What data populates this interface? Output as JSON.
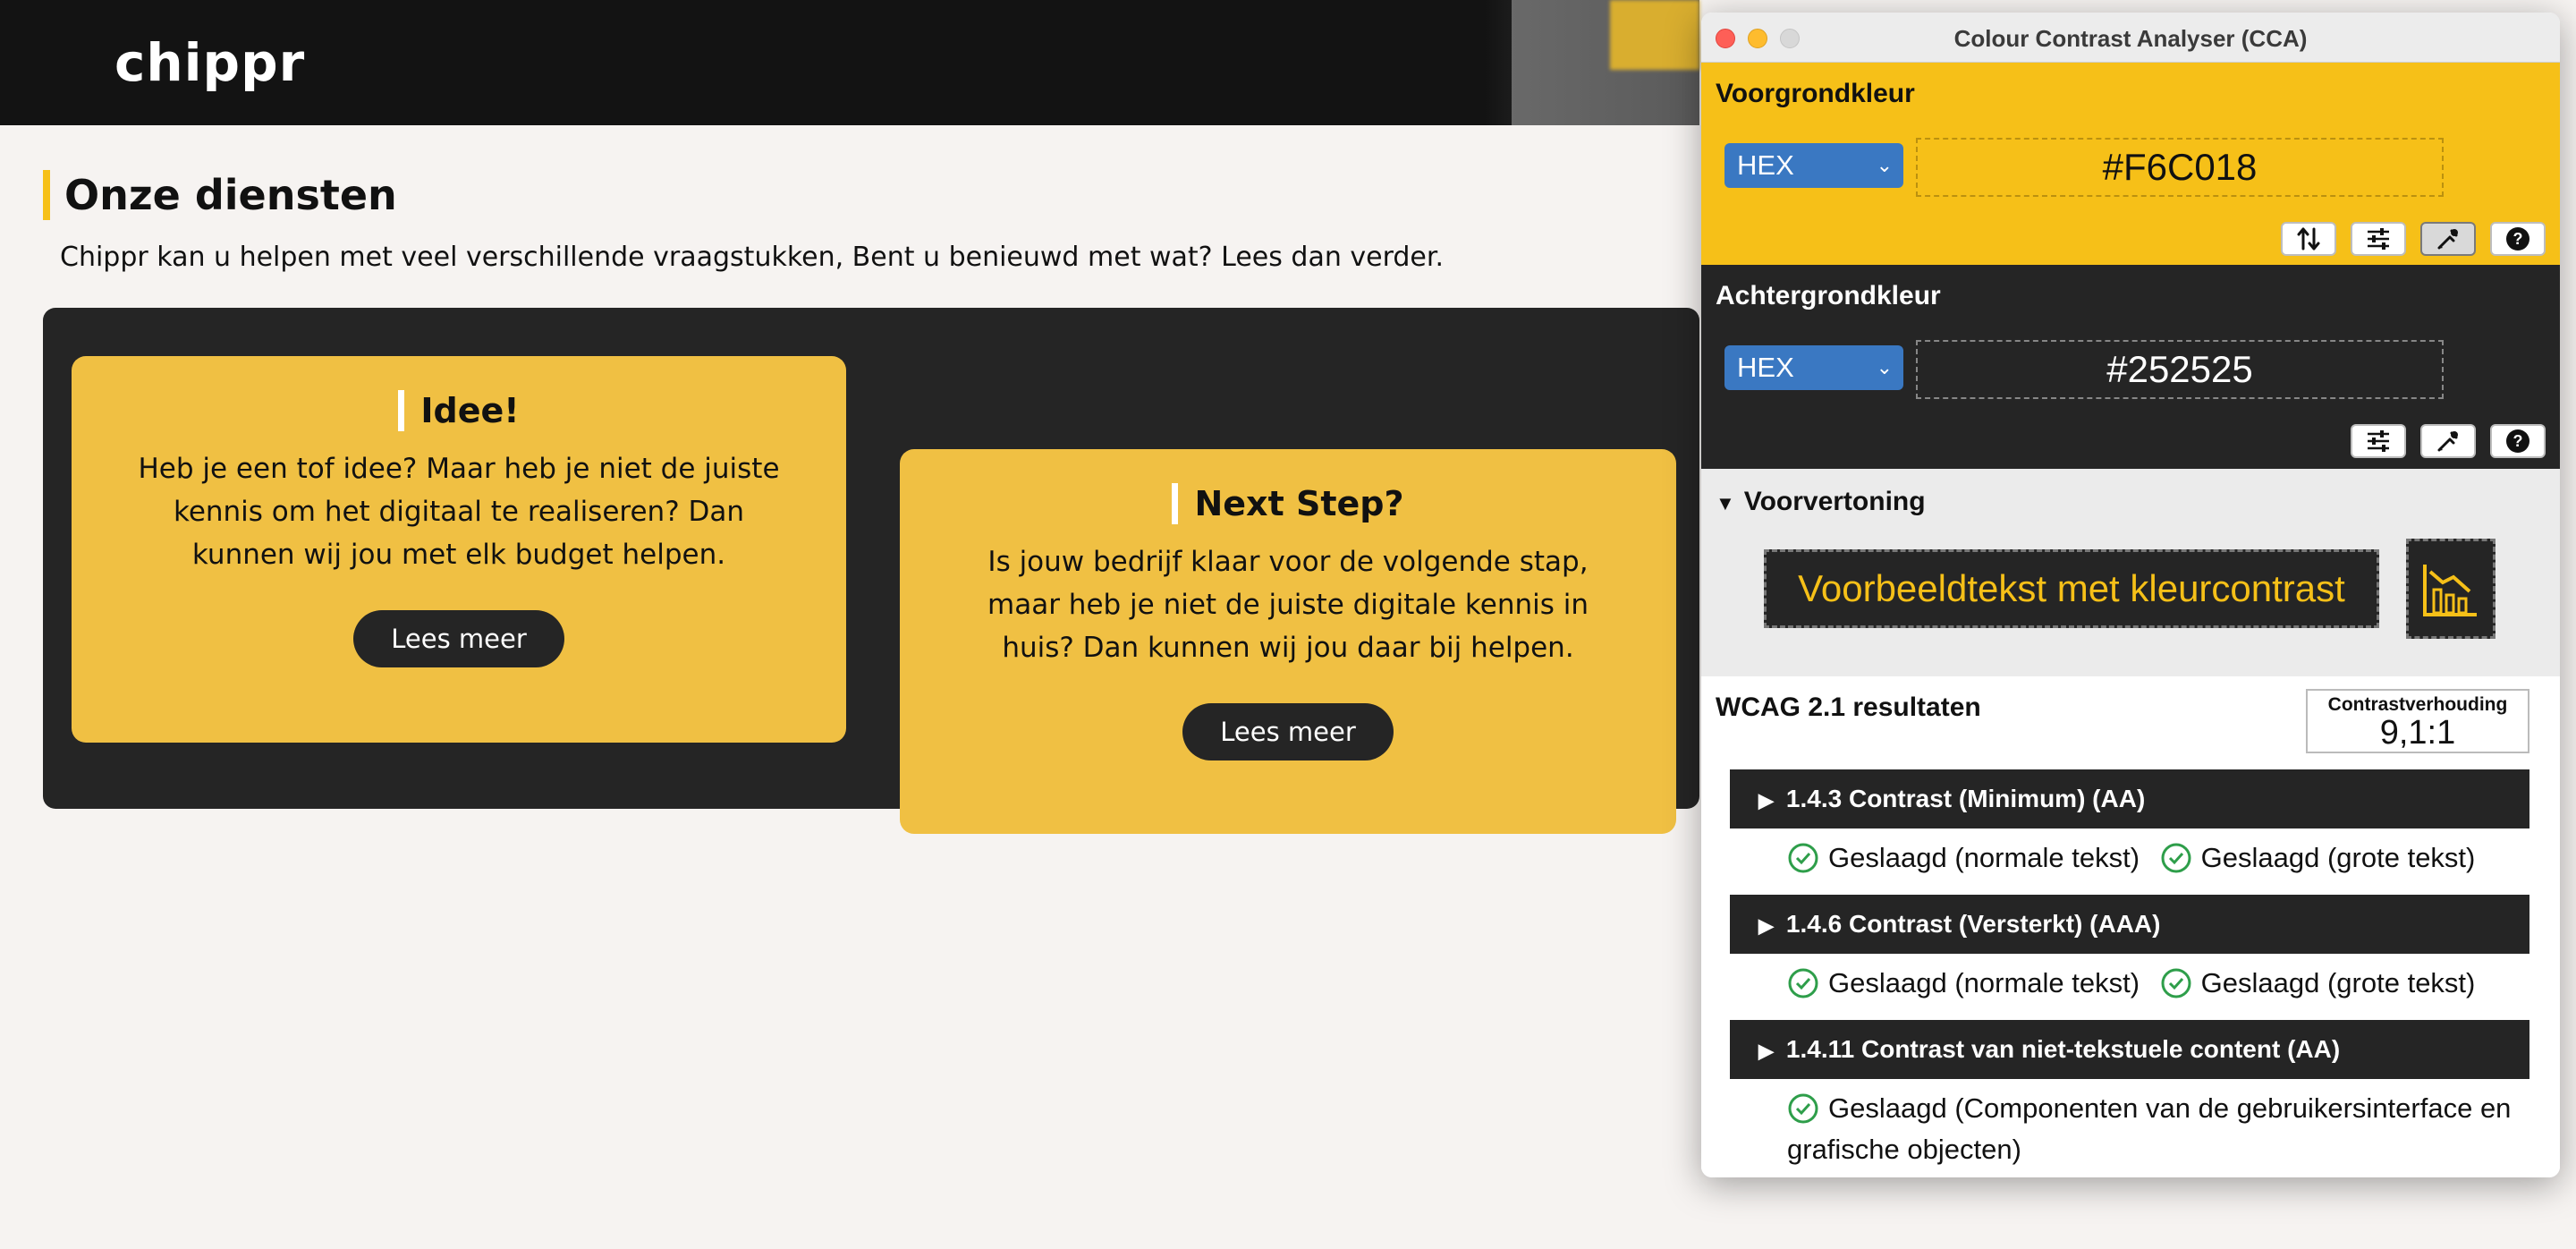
{
  "site": {
    "logo": "chippr",
    "section_title": "Onze diensten",
    "section_subtitle": "Chippr kan u helpen met veel verschillende vraagstukken, Bent u benieuwd met wat? Lees dan verder.",
    "cards": [
      {
        "title": "Idee!",
        "text": "Heb je een tof idee? Maar heb je niet de juiste kennis om het digitaal te realiseren? Dan kunnen wij jou met elk budget helpen.",
        "button": "Lees meer"
      },
      {
        "title": "Next Step?",
        "text": "Is jouw bedrijf klaar voor de volgende stap, maar heb je niet de juiste digitale kennis in huis? Dan kunnen wij jou daar bij helpen.",
        "button": "Lees meer"
      }
    ],
    "colors": {
      "accent": "#f6c018",
      "dark": "#252525",
      "card": "#f0c043"
    }
  },
  "cca": {
    "window_title": "Colour Contrast Analyser (CCA)",
    "foreground": {
      "label": "Voorgrondkleur",
      "format": "HEX",
      "value": "#F6C018"
    },
    "background": {
      "label": "Achtergrondkleur",
      "format": "HEX",
      "value": "#252525"
    },
    "toolbar_icons": [
      "swap-icon",
      "sliders-icon",
      "eyedropper-icon",
      "help-icon"
    ],
    "preview": {
      "label": "Voorvertoning",
      "sample_text": "Voorbeeldtekst met kleurcontrast"
    },
    "results": {
      "label": "WCAG 2.1 resultaten",
      "ratio_label": "Contrastverhouding",
      "ratio_value": "9,1:1",
      "criteria": [
        {
          "title": "1.4.3 Contrast (Minimum) (AA)",
          "results": [
            "Geslaagd (normale tekst)",
            "Geslaagd (grote tekst)"
          ]
        },
        {
          "title": "1.4.6 Contrast (Versterkt) (AAA)",
          "results": [
            "Geslaagd (normale tekst)",
            "Geslaagd (grote tekst)"
          ]
        },
        {
          "title": "1.4.11 Contrast van niet-tekstuele content (AA)",
          "results": [
            "Geslaagd (Componenten van de gebruikersinterface en",
            "grafische objecten)"
          ]
        }
      ]
    }
  }
}
